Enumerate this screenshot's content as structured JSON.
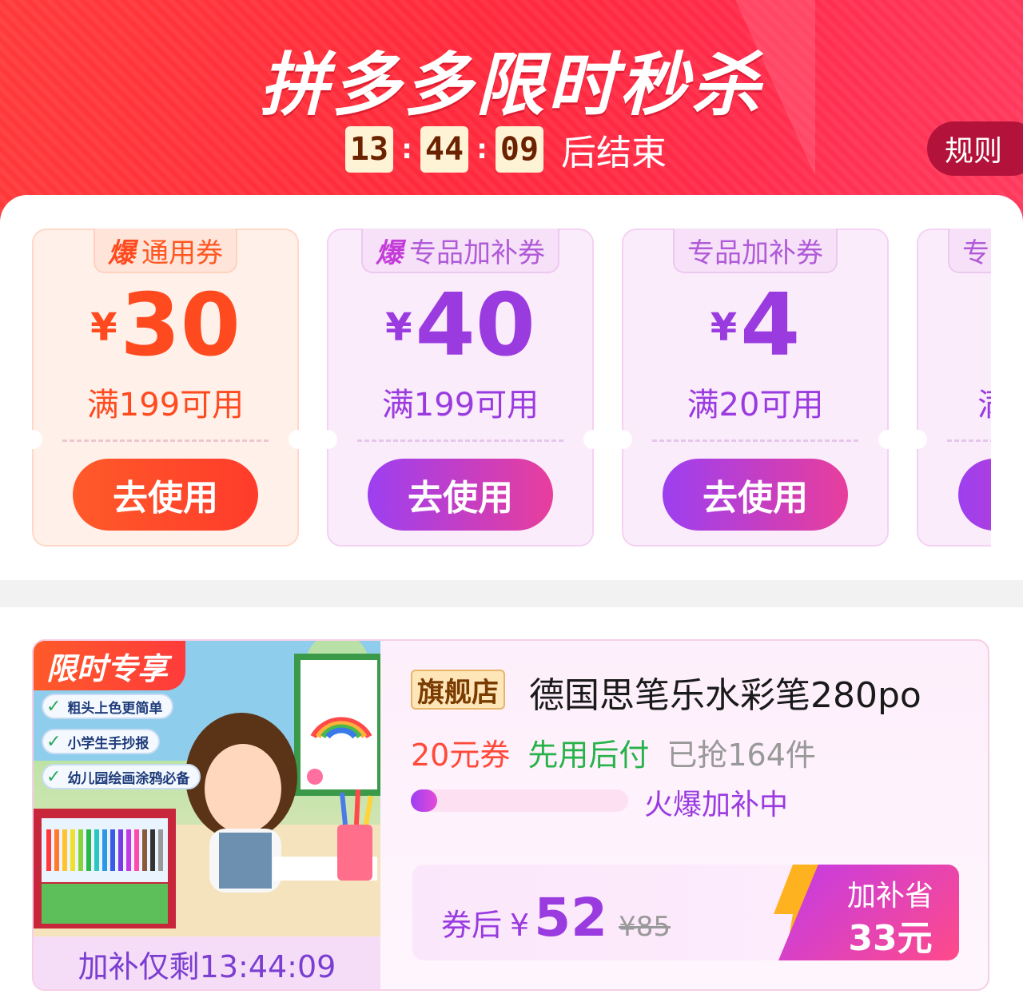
{
  "header": {
    "title": "拼多多限时秒杀",
    "countdown": {
      "hours": "13",
      "minutes": "44",
      "seconds": "09",
      "separator": ":",
      "suffix": "后结束"
    },
    "rules_label": "规则"
  },
  "coupons": [
    {
      "hot_mark": "爆",
      "tag": "通用券",
      "currency": "¥",
      "amount": "30",
      "condition": "满199可用",
      "button": "去使用",
      "theme": "orange"
    },
    {
      "hot_mark": "爆",
      "tag": "专品加补券",
      "currency": "¥",
      "amount": "40",
      "condition": "满199可用",
      "button": "去使用",
      "theme": "purple"
    },
    {
      "hot_mark": "",
      "tag": "专品加补券",
      "currency": "¥",
      "amount": "4",
      "condition": "满20可用",
      "button": "去使用",
      "theme": "purple"
    },
    {
      "hot_mark": "",
      "tag": "专",
      "currency": "",
      "amount": "",
      "condition": "满",
      "button": "",
      "theme": "purple"
    }
  ],
  "product": {
    "image_ribbon": "限时专享",
    "image_features": [
      "粗头上色更简单",
      "小学生手抄报",
      "幼儿园绘画涂鸦必备"
    ],
    "subsidy_timer": "加补仅剩13:44:09",
    "store_badge": "旗舰店",
    "name": "德国思笔乐水彩笔280po",
    "coupon_label": "20元券",
    "pay_label": "先用后付",
    "sold_label": "已抢164件",
    "progress": 0.12,
    "hot_label": "火爆加补中",
    "price_prefix": "券后",
    "currency": "¥",
    "price": "52",
    "original_price": "¥85",
    "save_label": "加补省",
    "save_amount": "33元"
  },
  "colors": {
    "header_red": "#ff2a3c",
    "orange_accent": "#ff4a1f",
    "purple_accent": "#9a3be0",
    "green_accent": "#27b34a"
  }
}
